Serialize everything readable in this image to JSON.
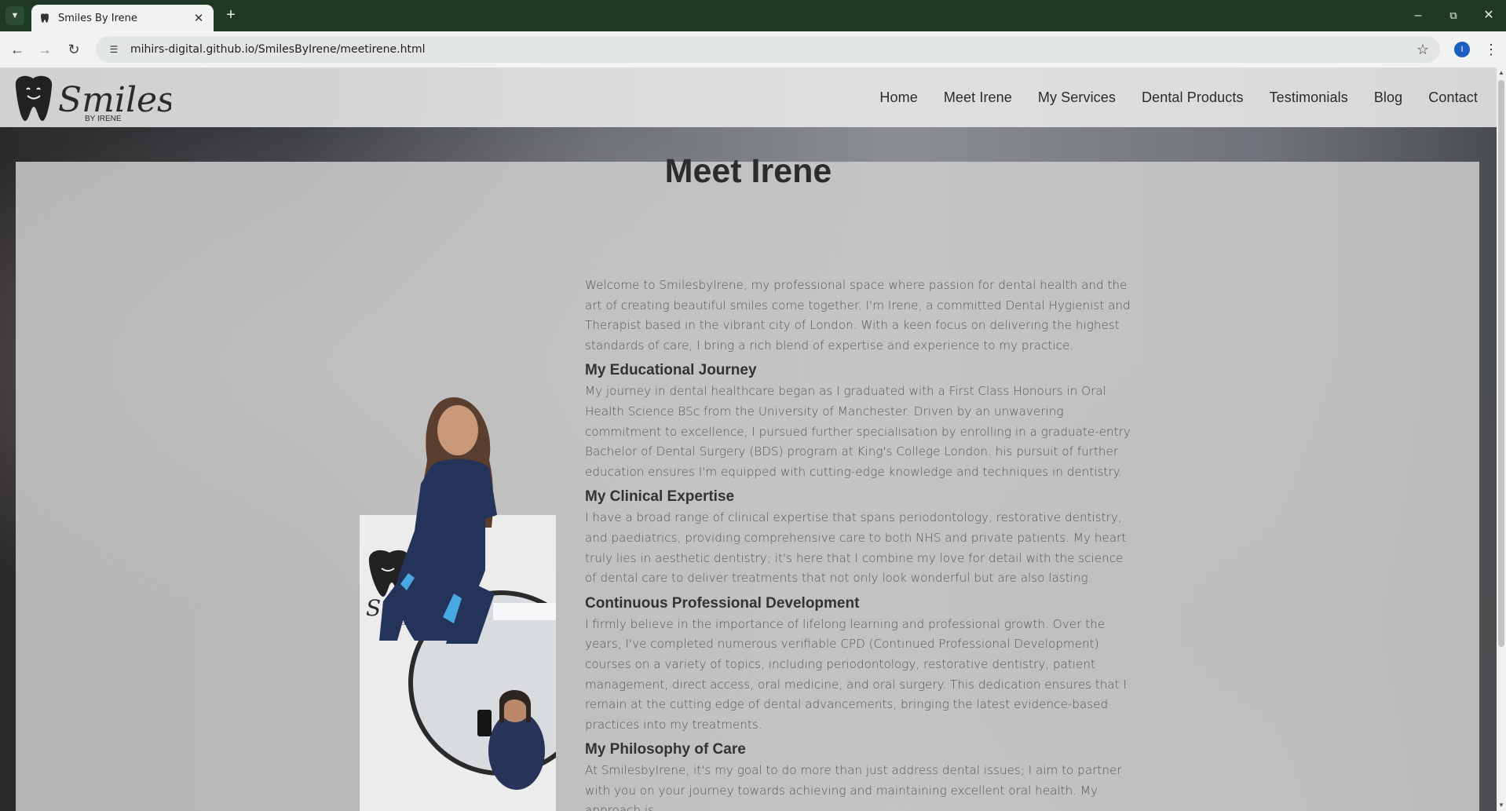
{
  "browser": {
    "tab_title": "Smiles By Irene",
    "url": "mihirs-digital.github.io/SmilesByIrene/meetirene.html",
    "profile_initial": "I"
  },
  "site": {
    "logo_text": "Smiles",
    "logo_subtext": "BY IRENE",
    "nav": [
      "Home",
      "Meet Irene",
      "My Services",
      "Dental Products",
      "Testimonials",
      "Blog",
      "Contact"
    ]
  },
  "page": {
    "title": "Meet Irene",
    "intro": "Welcome to SmilesbyIrene, my professional space where passion for dental health and the art of creating beautiful smiles come together. I'm Irene, a committed Dental Hygienist and Therapist based in the vibrant city of London. With a keen focus on delivering the highest standards of care, I bring a rich blend of expertise and experience to my practice.",
    "sections": [
      {
        "heading": "My Educational Journey",
        "body": "My journey in dental healthcare began as I graduated with a First Class Honours in Oral Health Science BSc from the University of Manchester. Driven by an unwavering commitment to excellence, I pursued further specialisation by enrolling in a graduate-entry Bachelor of Dental Surgery (BDS) program at King's College London. his pursuit of further education ensures I'm equipped with cutting-edge knowledge and techniques in dentistry."
      },
      {
        "heading": "My Clinical Expertise",
        "body": "I have a broad range of clinical expertise that spans periodontology, restorative dentistry, and paediatrics, providing comprehensive care to both NHS and private patients. My heart truly lies in aesthetic dentistry; it's here that I combine my love for detail with the science of dental care to deliver treatments that not only look wonderful but are also lasting."
      },
      {
        "heading": "Continuous Professional Development",
        "body": "I firmly believe in the importance of lifelong learning and professional growth. Over the years, I've completed numerous verifiable CPD (Continued Professional Development) courses on a variety of topics, including periodontology, restorative dentistry, patient management, direct access, oral medicine, and oral surgery. This dedication ensures that I remain at the cutting edge of dental advancements, bringing the latest evidence-based practices into my treatments."
      },
      {
        "heading": "My Philosophy of Care",
        "body": "At SmilesbyIrene, it's my goal to do more than just address dental issues; I aim to partner with you on your journey towards achieving and maintaining excellent oral health. My approach is"
      }
    ]
  }
}
